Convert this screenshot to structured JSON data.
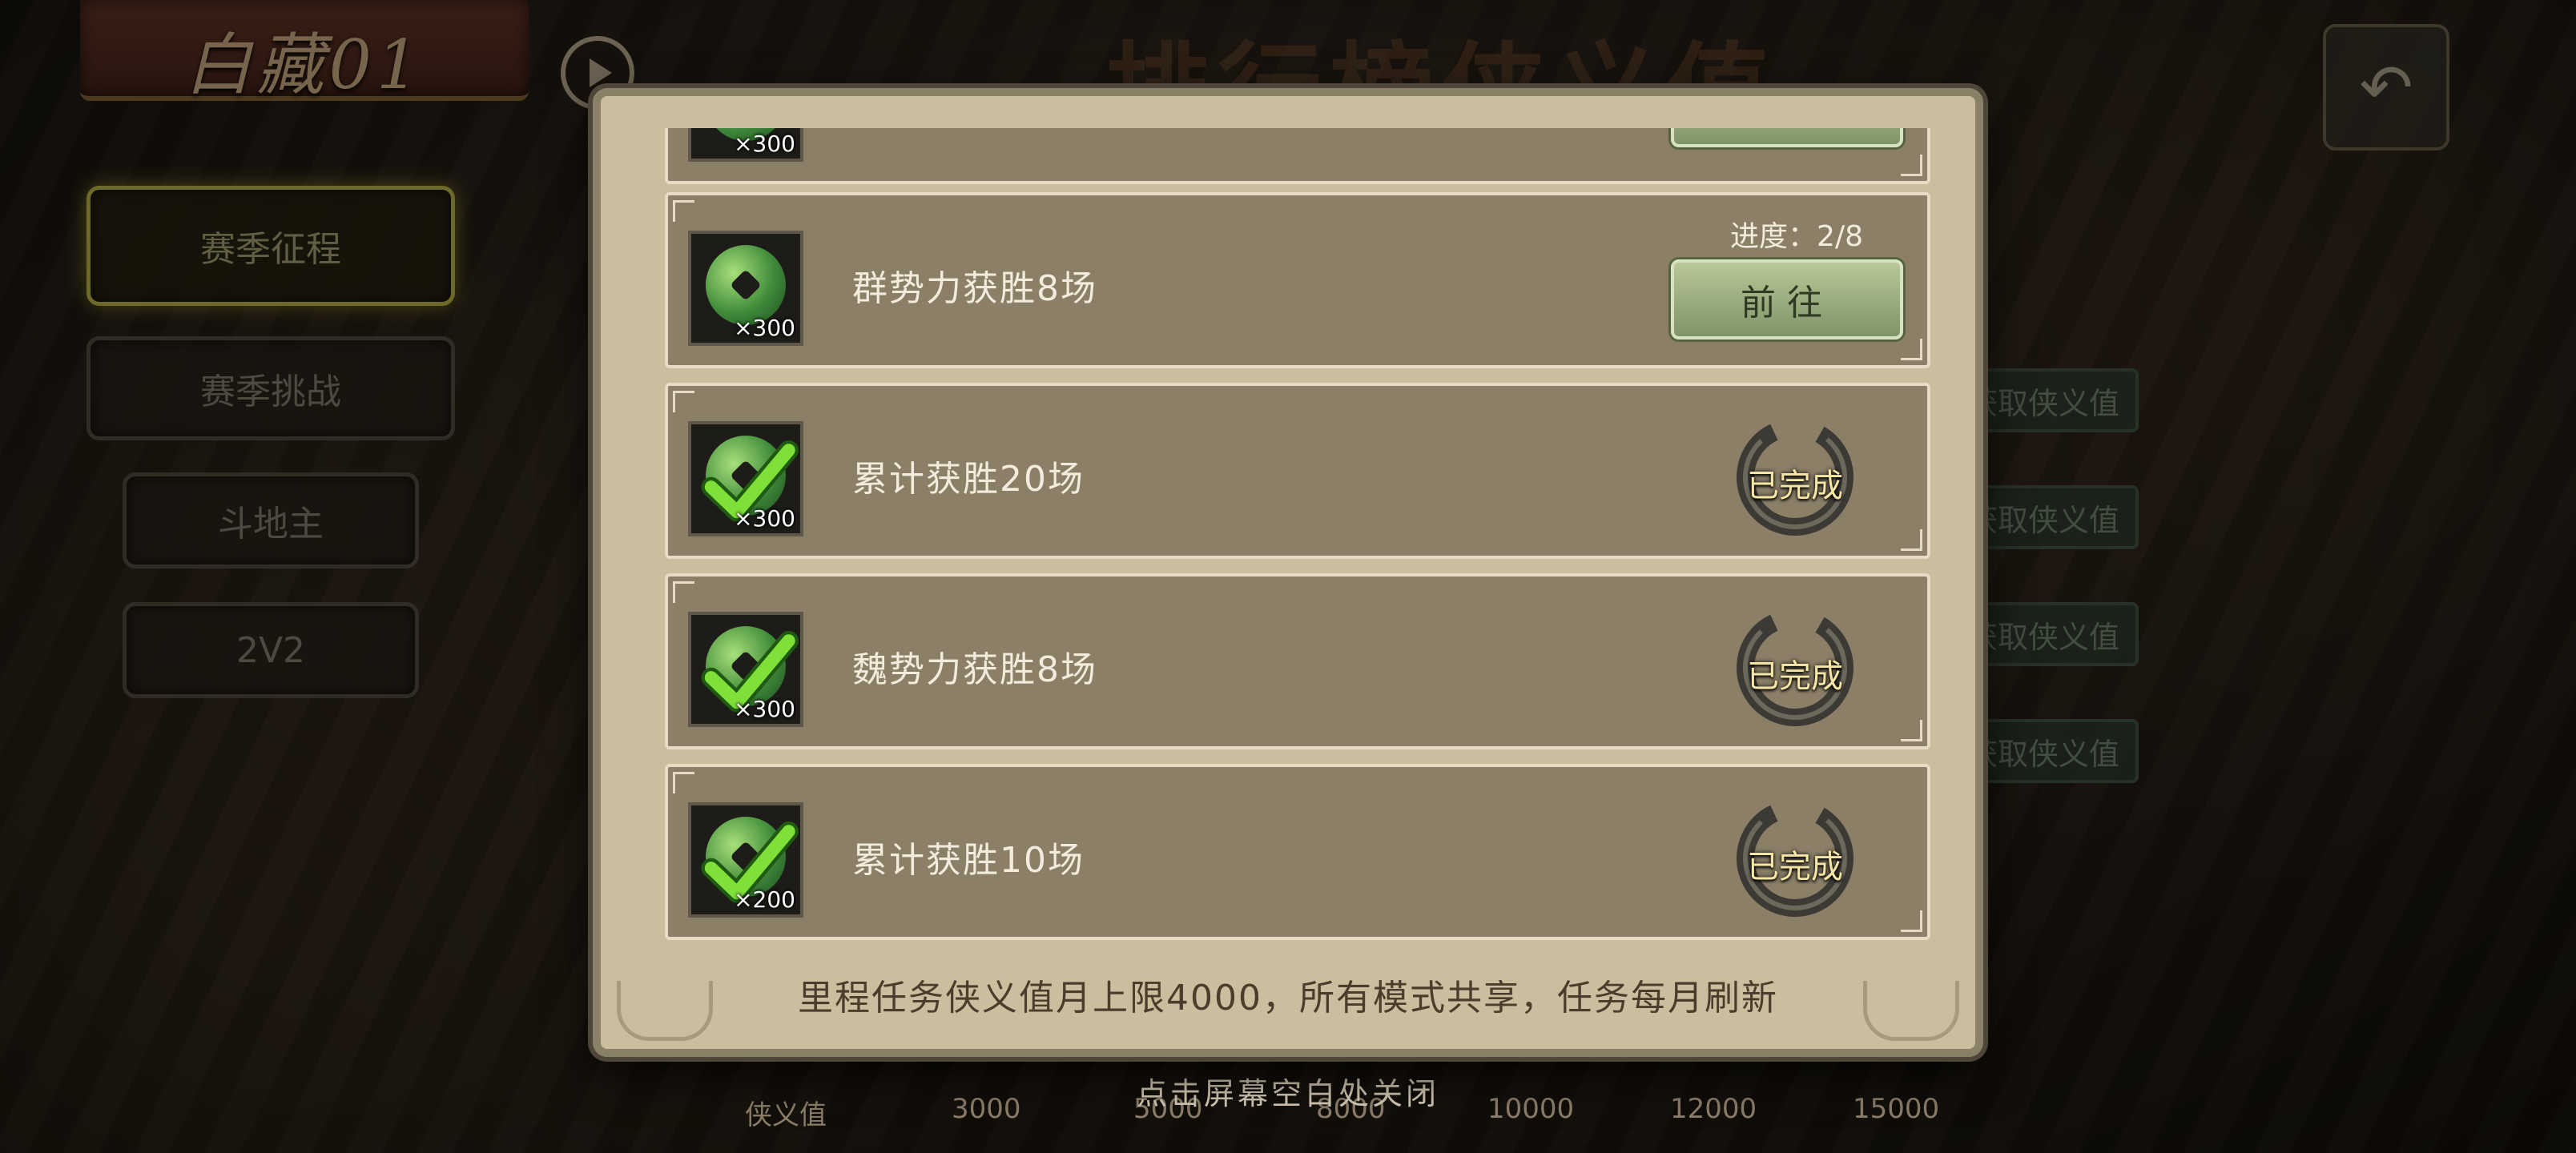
{
  "header": {
    "banner_title": "白藏01",
    "background_title": "排行榜侠义值"
  },
  "left_nav": {
    "items": [
      {
        "label": "赛季征程",
        "active": true
      },
      {
        "label": "赛季挑战",
        "active": false
      },
      {
        "label": "斗地主",
        "active": false
      },
      {
        "label": "2V2",
        "active": false
      }
    ]
  },
  "side_buttons": [
    "获取侠义值",
    "获取侠义值",
    "获取侠义值",
    "获取侠义值"
  ],
  "bottom_bar": {
    "label": "侠义值",
    "milestones": [
      "3000",
      "5000",
      "8000",
      "10000",
      "12000",
      "15000"
    ],
    "close_hint": "点击屏幕空白处关闭"
  },
  "modal": {
    "tasks": [
      {
        "name": "",
        "quantity": "×300",
        "completed": false,
        "progress": "",
        "button": ""
      },
      {
        "name": "群势力获胜8场",
        "quantity": "×300",
        "completed": false,
        "progress": "进度：2/8",
        "button": "前往"
      },
      {
        "name": "累计获胜20场",
        "quantity": "×300",
        "completed": true,
        "status": "已完成"
      },
      {
        "name": "魏势力获胜8场",
        "quantity": "×300",
        "completed": true,
        "status": "已完成"
      },
      {
        "name": "累计获胜10场",
        "quantity": "×200",
        "completed": true,
        "status": "已完成"
      }
    ],
    "footer": "里程任务侠义值月上限4000，所有模式共享，任务每月刷新"
  },
  "colors": {
    "accent_active_nav": "#c6c04a",
    "panel_bg": "#cbbe9e",
    "row_bg": "#8b7f68",
    "go_button": "#9fb07f"
  }
}
